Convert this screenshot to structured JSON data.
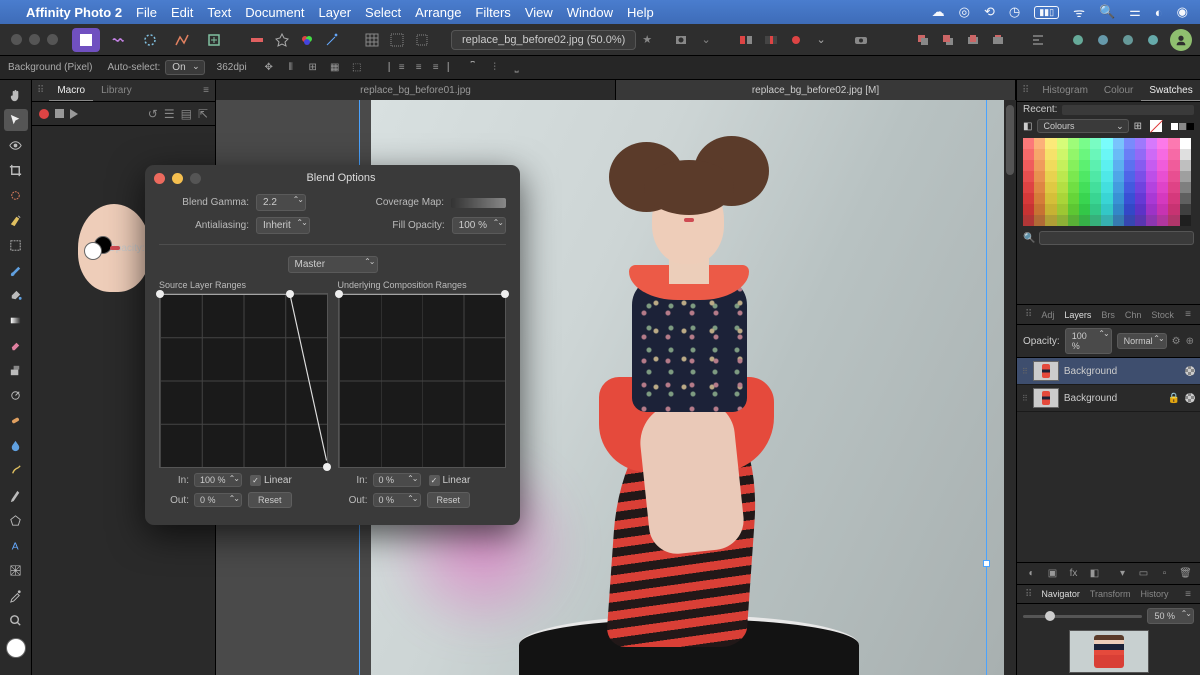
{
  "menubar": {
    "app": "Affinity Photo 2",
    "items": [
      "File",
      "Edit",
      "Text",
      "Document",
      "Layer",
      "Select",
      "Arrange",
      "Filters",
      "View",
      "Window",
      "Help"
    ]
  },
  "toolbar": {
    "doc_title": "replace_bg_before02.jpg (50.0%)"
  },
  "context": {
    "layer_label": "Background (Pixel)",
    "autoselect_label": "Auto-select:",
    "autoselect_value": "On",
    "resolution": "362dpi"
  },
  "leftpanel": {
    "tabs": [
      "Macro",
      "Library"
    ]
  },
  "doctabs": [
    "replace_bg_before01.jpg",
    "replace_bg_before02.jpg [M]"
  ],
  "dialog": {
    "title": "Blend Options",
    "blend_gamma_label": "Blend Gamma:",
    "blend_gamma_value": "2.2",
    "coverage_label": "Coverage Map:",
    "antialias_label": "Antialiasing:",
    "antialias_value": "Inherit",
    "fillopacity_label": "Fill Opacity:",
    "fillopacity_value": "100 %",
    "channel": "Master",
    "src_label": "Source Layer Ranges",
    "under_label": "Underlying Composition Ranges",
    "in_label": "In:",
    "out_label": "Out:",
    "src_in": "100 %",
    "src_out": "0 %",
    "under_in": "0 %",
    "under_out": "0 %",
    "linear_label": "Linear",
    "reset_label": "Reset"
  },
  "right": {
    "top_tabs": [
      "Histogram",
      "Colour",
      "Swatches"
    ],
    "opacity_label": "Opacity:",
    "opacity_value": "100 %",
    "recent_label": "Recent:",
    "palette": "Colours",
    "layer_tabs": [
      "Adj",
      "Layers",
      "Brs",
      "Chn",
      "Stock"
    ],
    "layer_opacity_label": "Opacity:",
    "layer_opacity_value": "100 %",
    "blend_mode": "Normal",
    "layers": [
      {
        "name": "Background"
      },
      {
        "name": "Background"
      }
    ],
    "nav_tabs": [
      "Navigator",
      "Transform",
      "History"
    ],
    "zoom": "50 %"
  }
}
